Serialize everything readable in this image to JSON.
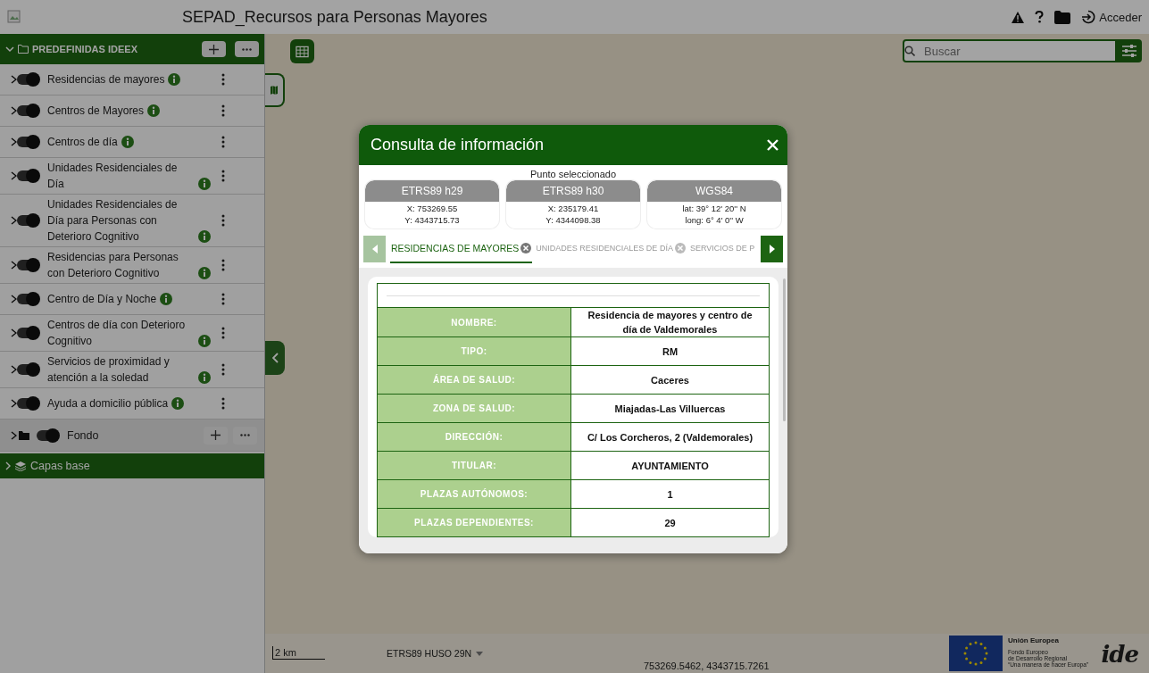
{
  "header": {
    "title": "SEPAD_Recursos para Personas Mayores",
    "login": "Acceder"
  },
  "sidebar": {
    "group": {
      "title": "PREDEFINIDAS IDEEX",
      "expanded": true
    },
    "layers": [
      {
        "name": "Residencias de mayores",
        "on": true
      },
      {
        "name": "Centros de Mayores",
        "on": true
      },
      {
        "name": "Centros de día",
        "on": true
      },
      {
        "name": "Unidades Residenciales de Día",
        "on": true
      },
      {
        "name": "Unidades Residenciales de Día para Personas con Deterioro Cognitivo",
        "on": true
      },
      {
        "name": "Residencias para Personas con Deterioro Cognitivo",
        "on": true
      },
      {
        "name": "Centro de Día y Noche",
        "on": true
      },
      {
        "name": "Centros de día con Deterioro Cognitivo",
        "on": true
      },
      {
        "name": "Servicios de proximidad y atención a la soledad",
        "on": true
      },
      {
        "name": "Ayuda a domicilio pública",
        "on": true
      }
    ],
    "background_group": {
      "title": "Fondo",
      "on": true,
      "expanded": false
    },
    "base_group": {
      "title": "Capas base",
      "expanded": false
    }
  },
  "map": {
    "search": {
      "placeholder": "Buscar"
    },
    "scale": "2 km",
    "projection": "ETRS89 HUSO 29N",
    "coordinates": "753269.5462, 4343715.7261",
    "eu_logo": {
      "title": "Unión Europea",
      "lines": [
        "Fondo Europeo",
        "de Desarrollo Regional",
        "“Una manera de hacer Europa”"
      ]
    },
    "ide_logo": "ide"
  },
  "dialog": {
    "title": "Consulta de información",
    "point_label": "Punto seleccionado",
    "coordinate_systems": [
      {
        "name": "ETRS89 h29",
        "lines": [
          "X: 753269.55",
          "Y: 4343715.73"
        ]
      },
      {
        "name": "ETRS89 h30",
        "lines": [
          "X: 235179.41",
          "Y: 4344098.38"
        ]
      },
      {
        "name": "WGS84",
        "lines": [
          "lat: 39° 12' 20'' N",
          "long: 6° 4' 0'' W"
        ]
      }
    ],
    "tab_scroll": {
      "left_disabled": true,
      "right_disabled": false
    },
    "tabs": [
      {
        "label": "RESIDENCIAS DE MAYORES",
        "selected": true
      },
      {
        "label": "UNIDADES RESIDENCIALES DE DÍA",
        "selected": false
      },
      {
        "label": "SERVICIOS DE P",
        "selected": false
      }
    ],
    "table": {
      "rows": [
        {
          "label": "NOMBRE:",
          "value": "Residencia de mayores y centro de día de Valdemorales"
        },
        {
          "label": "TIPO:",
          "value": "RM"
        },
        {
          "label": "ÁREA DE SALUD:",
          "value": "Caceres"
        },
        {
          "label": "ZONA DE SALUD:",
          "value": "Miajadas-Las Villuercas"
        },
        {
          "label": "DIRECCIÓN:",
          "value": "C/ Los Corcheros, 2 (Valdemorales)"
        },
        {
          "label": "TITULAR:",
          "value": "AYUNTAMIENTO"
        },
        {
          "label": "PLAZAS AUTÓNOMOS:",
          "value": "1"
        },
        {
          "label": "PLAZAS DEPENDIENTES:",
          "value": "29"
        }
      ]
    }
  }
}
